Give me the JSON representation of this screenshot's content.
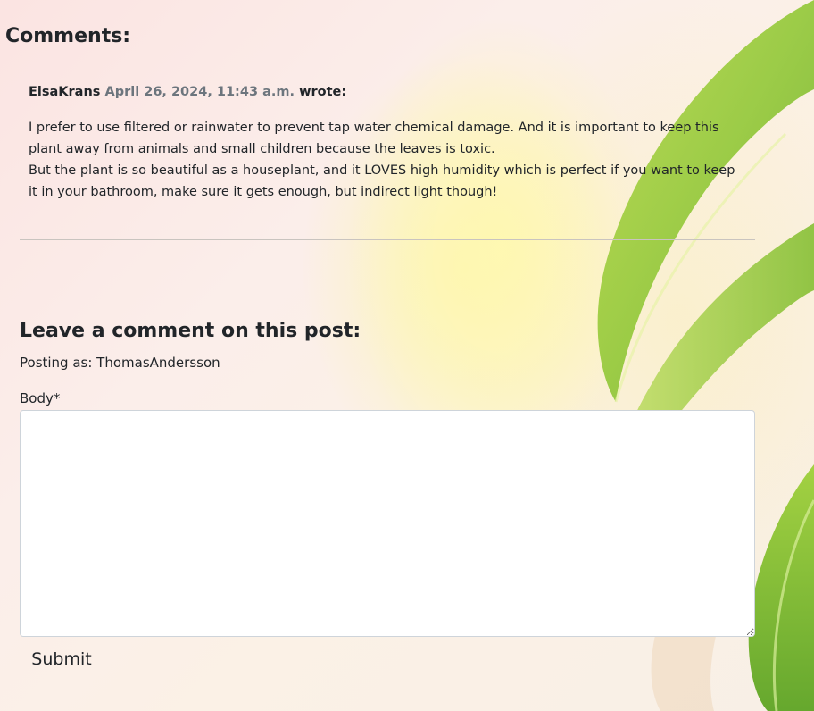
{
  "comments_section": {
    "heading": "Comments:"
  },
  "comments": [
    {
      "author": "ElsaKrans",
      "date": "April 26, 2024, 11:43 a.m.",
      "wrote": "wrote:",
      "body_lines": [
        "I prefer to use filtered or rainwater to prevent tap water chemical damage. And it is important to keep this plant away from animals and small children because the leaves is toxic.",
        "But the plant is so beautiful as a houseplant, and it LOVES high humidity which is perfect if you want to keep it in your bathroom, make sure it gets enough, but indirect light though!"
      ]
    }
  ],
  "comment_form": {
    "heading": "Leave a comment on this post:",
    "posting_as": "Posting as: ThomasAndersson",
    "body_label": "Body*",
    "body_value": "",
    "submit_label": "Submit"
  },
  "colors": {
    "text": "#212529",
    "muted_date": "#6c757d",
    "leaf_green": "#8cc63f"
  }
}
